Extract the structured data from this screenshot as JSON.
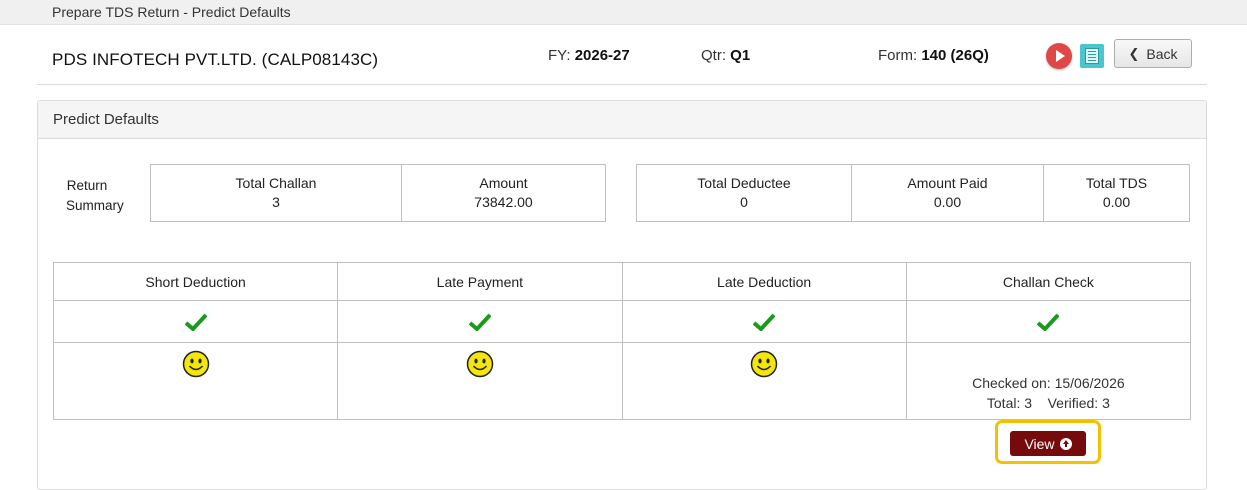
{
  "breadcrumb": "Prepare TDS Return - Predict Defaults",
  "header": {
    "company": "PDS INFOTECH PVT.LTD. (CALP08143C)",
    "fy_label": "FY:",
    "fy_value": "2026-27",
    "qtr_label": "Qtr:",
    "qtr_value": "Q1",
    "form_label": "Form:",
    "form_value": "140 (26Q)",
    "back_label": "Back",
    "icons": [
      "play-icon",
      "calculator-icon",
      "chevron-left-icon"
    ]
  },
  "panel": {
    "title": "Predict Defaults",
    "return_summary_label_1": "Return",
    "return_summary_label_2": "Summary",
    "summary_left": [
      {
        "header": "Total Challan",
        "value": "3"
      },
      {
        "header": "Amount",
        "value": "73842.00"
      }
    ],
    "summary_right": [
      {
        "header": "Total Deductee",
        "value": "0"
      },
      {
        "header": "Amount Paid",
        "value": "0.00"
      },
      {
        "header": "Total TDS",
        "value": "0.00"
      }
    ],
    "checks": [
      {
        "header": "Short Deduction",
        "status_icon": "checkmark-icon",
        "result_icon": "smiley-icon"
      },
      {
        "header": "Late Payment",
        "status_icon": "checkmark-icon",
        "result_icon": "smiley-icon"
      },
      {
        "header": "Late Deduction",
        "status_icon": "checkmark-icon",
        "result_icon": "smiley-icon"
      },
      {
        "header": "Challan Check",
        "status_icon": "checkmark-icon",
        "checked_on": "Checked on: 15/06/2026",
        "totals": "Total: 3    Verified: 3"
      }
    ],
    "view_label": "View"
  },
  "colors": {
    "check_green": "#1a9a1a",
    "smiley_yellow": "#f5e60a",
    "view_button": "#760b0b",
    "highlight": "#f2c200",
    "play_red": "#e04848",
    "calc_teal": "#4bc6cf"
  }
}
